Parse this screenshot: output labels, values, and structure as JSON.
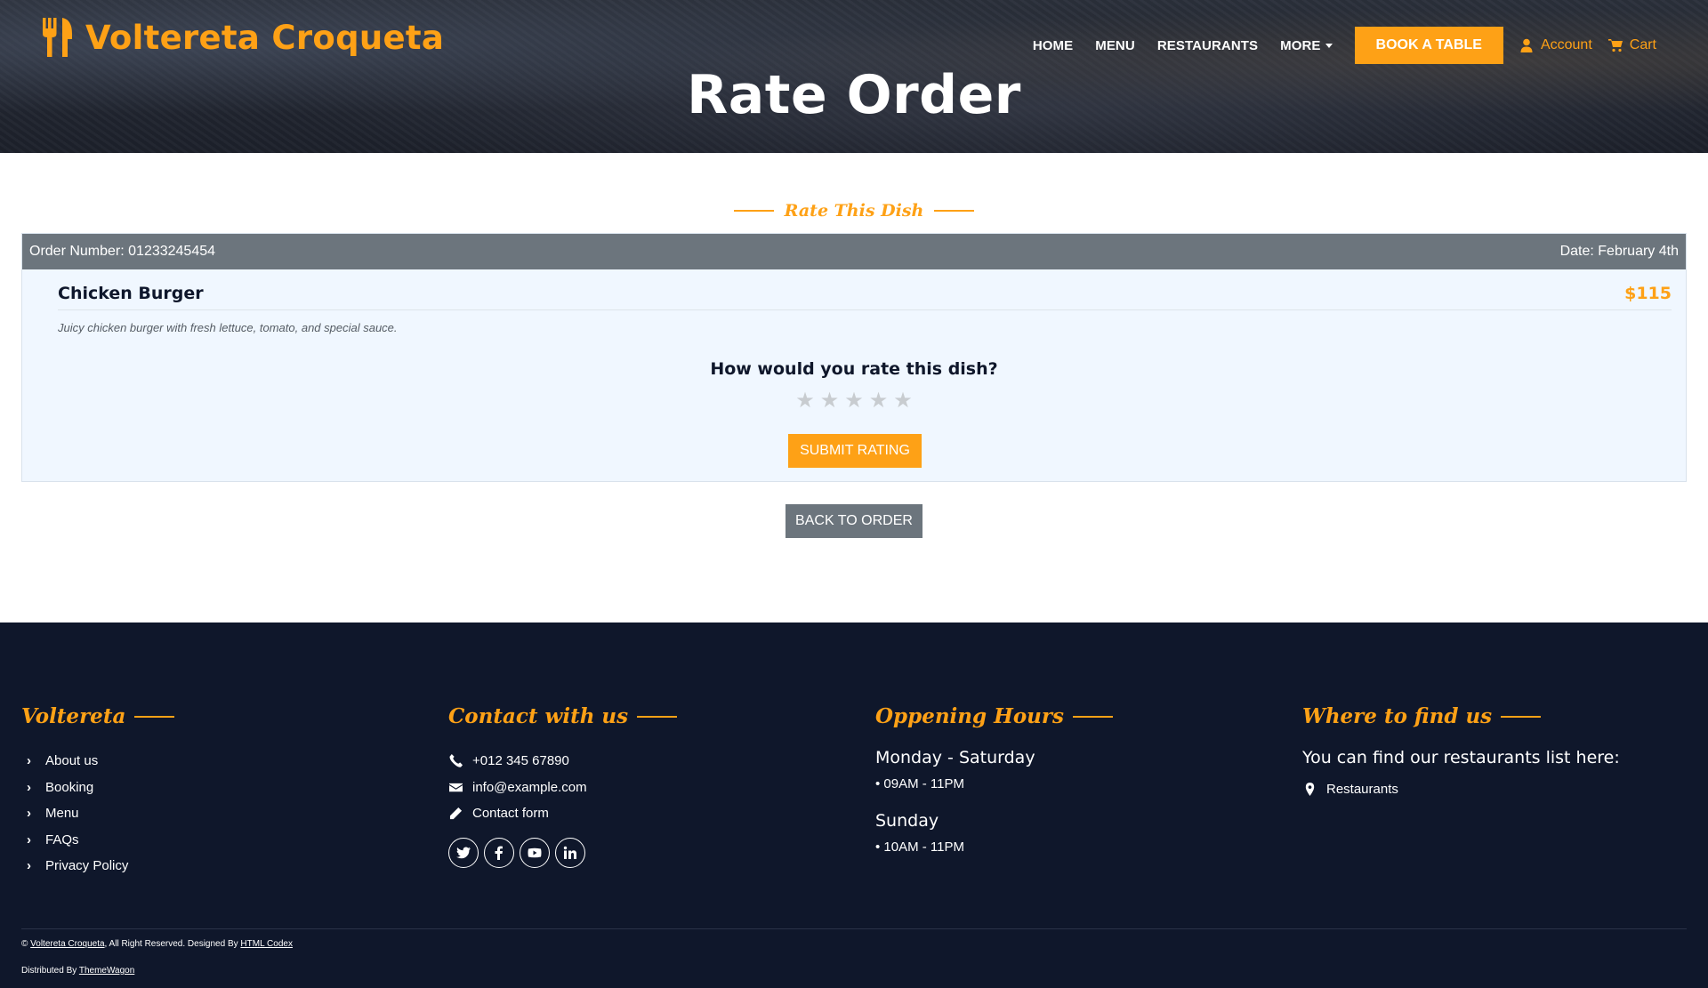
{
  "brand": {
    "name": "Voltereta Croqueta",
    "icon": "utensils-icon"
  },
  "nav": {
    "items": [
      "HOME",
      "MENU",
      "RESTAURANTS",
      "MORE"
    ],
    "book_label": "BOOK A TABLE",
    "account_label": "Account",
    "cart_label": "Cart"
  },
  "hero": {
    "title": "Rate Order"
  },
  "section": {
    "title": "Rate This Dish"
  },
  "order": {
    "number_label": "Order Number: 01233245454",
    "date_label": "Date: February 4th",
    "dish_name": "Chicken Burger",
    "dish_price": "$115",
    "dish_description": "Juicy chicken burger with fresh lettuce, tomato, and special sauce.",
    "rating_question": "How would you rate this dish?",
    "rating_value": 0,
    "rating_max": 5,
    "star_glyph": "★",
    "submit_label": "SUBMIT RATING",
    "back_label": "BACK TO ORDER"
  },
  "footer": {
    "col1": {
      "title": "Voltereta",
      "links": [
        "About us",
        "Booking",
        "Menu",
        "FAQs",
        "Privacy Policy"
      ]
    },
    "col2": {
      "title": "Contact with us",
      "phone": "+012 345 67890",
      "email": "info@example.com",
      "form": "Contact form",
      "socials": [
        "twitter-icon",
        "facebook-icon",
        "youtube-icon",
        "linkedin-icon"
      ]
    },
    "col3": {
      "title": "Oppening Hours",
      "weekday_label": "Monday - Saturday",
      "weekday_hours": "• 09AM - 11PM",
      "sunday_label": "Sunday",
      "sunday_hours": "• 10AM - 11PM"
    },
    "col4": {
      "title": "Where to find us",
      "text": "You can find our restaurants list here:",
      "link": "Restaurants"
    },
    "copyright": {
      "symbol": "©",
      "brand_link": "Voltereta Croqueta",
      "middle": ", All Right Reserved. Designed By",
      "designer_link": "HTML Codex"
    },
    "distributed": {
      "prefix": "Distributed By",
      "link": "ThemeWagon"
    }
  },
  "colors": {
    "accent": "#fea116",
    "dark": "#0f172b",
    "secondary": "#6c757d",
    "card_bg": "#f0f7ff"
  }
}
